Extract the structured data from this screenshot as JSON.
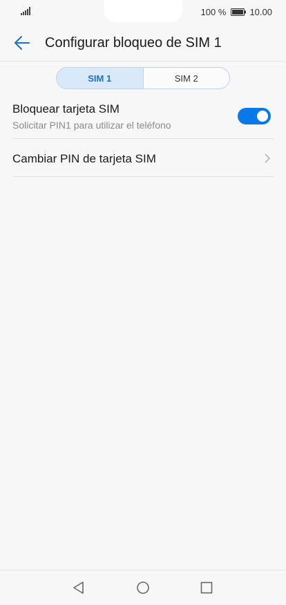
{
  "status_bar": {
    "battery_percent": "100 %",
    "time": "10.00",
    "icons": [
      "signal-icon",
      "battery-icon"
    ]
  },
  "app_bar": {
    "title": "Configurar bloqueo de SIM 1",
    "back_icon": "arrow-left-icon"
  },
  "sim_tabs": [
    {
      "label": "SIM 1",
      "selected": true
    },
    {
      "label": "SIM 2",
      "selected": false
    }
  ],
  "settings": {
    "lock_sim": {
      "title": "Bloquear tarjeta SIM",
      "subtitle": "Solicitar PIN1 para utilizar el teléfono",
      "enabled": true
    },
    "change_pin": {
      "label": "Cambiar PIN de tarjeta SIM",
      "icon": "chevron-right-icon"
    }
  },
  "nav_bar": {
    "icons": [
      "back-triangle-icon",
      "home-circle-icon",
      "recents-square-icon"
    ]
  },
  "colors": {
    "accent": "#0a78e8",
    "tab_active_bg": "#d9e9fa",
    "tab_active_text": "#1a73c9",
    "background": "#f7f7f7"
  }
}
